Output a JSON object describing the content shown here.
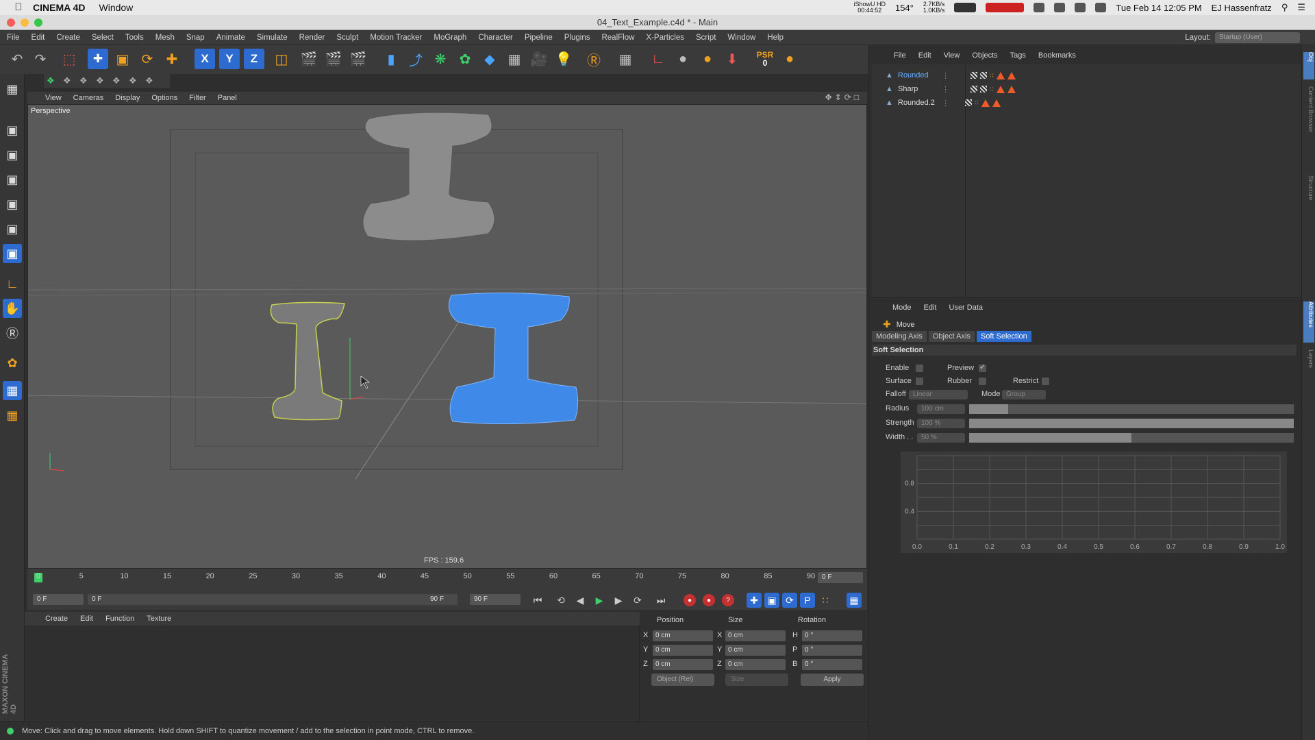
{
  "mac": {
    "app_name": "CINEMA 4D",
    "menu": [
      "Window"
    ],
    "datetime": "Tue Feb 14  12:05 PM",
    "user": "EJ Hassenfratz",
    "screenrec": [
      "iShowU HD",
      "00:44:52"
    ],
    "temp": "154°",
    "net": [
      "2.7KB/s",
      "1.0KB/s"
    ]
  },
  "window": {
    "title": "04_Text_Example.c4d * - Main"
  },
  "menubar": [
    "File",
    "Edit",
    "Create",
    "Select",
    "Tools",
    "Mesh",
    "Snap",
    "Animate",
    "Simulate",
    "Render",
    "Sculpt",
    "Motion Tracker",
    "MoGraph",
    "Character",
    "Pipeline",
    "Plugins",
    "RealFlow",
    "X-Particles",
    "Script",
    "Window",
    "Help"
  ],
  "layout": {
    "label": "Layout:",
    "value": "Startup (User)"
  },
  "toolbar": {
    "axis_x": "X",
    "axis_y": "Y",
    "axis_z": "Z",
    "psr": "PSR",
    "psr_value": "0"
  },
  "viewport": {
    "menu": [
      "View",
      "Cameras",
      "Display",
      "Options",
      "Filter",
      "Panel"
    ],
    "camera": "Perspective",
    "fps": "FPS : 159.6"
  },
  "timeline": {
    "ticks": [
      "0",
      "5",
      "10",
      "15",
      "20",
      "25",
      "30",
      "35",
      "40",
      "45",
      "50",
      "55",
      "60",
      "65",
      "70",
      "75",
      "80",
      "85",
      "90"
    ],
    "current_frame_field": "0 F",
    "start": "0 F",
    "range_start": "0 F",
    "range_end": "90 F",
    "end": "90 F"
  },
  "material_menu": [
    "Create",
    "Edit",
    "Function",
    "Texture"
  ],
  "coords": {
    "headers": [
      "Position",
      "Size",
      "Rotation"
    ],
    "rows": [
      {
        "axis": "X",
        "pos": "0 cm",
        "size_axis": "X",
        "size": "0 cm",
        "rot_axis": "H",
        "rot": "0 °"
      },
      {
        "axis": "Y",
        "pos": "0 cm",
        "size_axis": "Y",
        "size": "0 cm",
        "rot_axis": "P",
        "rot": "0 °"
      },
      {
        "axis": "Z",
        "pos": "0 cm",
        "size_axis": "Z",
        "size": "0 cm",
        "rot_axis": "B",
        "rot": "0 °"
      }
    ],
    "mode": "Object (Rel)",
    "size_mode": "Size",
    "apply": "Apply"
  },
  "status": "Move: Click and drag to move elements. Hold down SHIFT to quantize movement / add to the selection in point mode, CTRL to remove.",
  "objects": {
    "menu": [
      "File",
      "Edit",
      "View",
      "Objects",
      "Tags",
      "Bookmarks"
    ],
    "items": [
      {
        "name": "Rounded",
        "selected": true
      },
      {
        "name": "Sharp",
        "selected": false
      },
      {
        "name": "Rounded.2",
        "selected": false
      }
    ]
  },
  "attributes": {
    "menu": [
      "Mode",
      "Edit",
      "User Data"
    ],
    "title": "Move",
    "tabs": [
      "Modeling Axis",
      "Object Axis",
      "Soft Selection"
    ],
    "section": "Soft Selection",
    "enable": "Enable",
    "preview": "Preview",
    "surface": "Surface",
    "rubber": "Rubber",
    "restrict": "Restrict",
    "falloff": "Falloff",
    "falloff_value": "Linear",
    "mode": "Mode",
    "mode_value": "Group",
    "radius": "Radius",
    "radius_value": "100 cm",
    "radius_fraction": 0.12,
    "strength": "Strength",
    "strength_value": "100 %",
    "strength_fraction": 1.0,
    "width": "Width . .",
    "width_value": "50 %",
    "width_fraction": 0.5,
    "graph_y": [
      "0.8",
      "0.4"
    ],
    "graph_x": [
      "0.0",
      "0.1",
      "0.2",
      "0.3",
      "0.4",
      "0.5",
      "0.6",
      "0.7",
      "0.8",
      "0.9",
      "1.0"
    ]
  },
  "branding": "MAXON CINEMA 4D"
}
